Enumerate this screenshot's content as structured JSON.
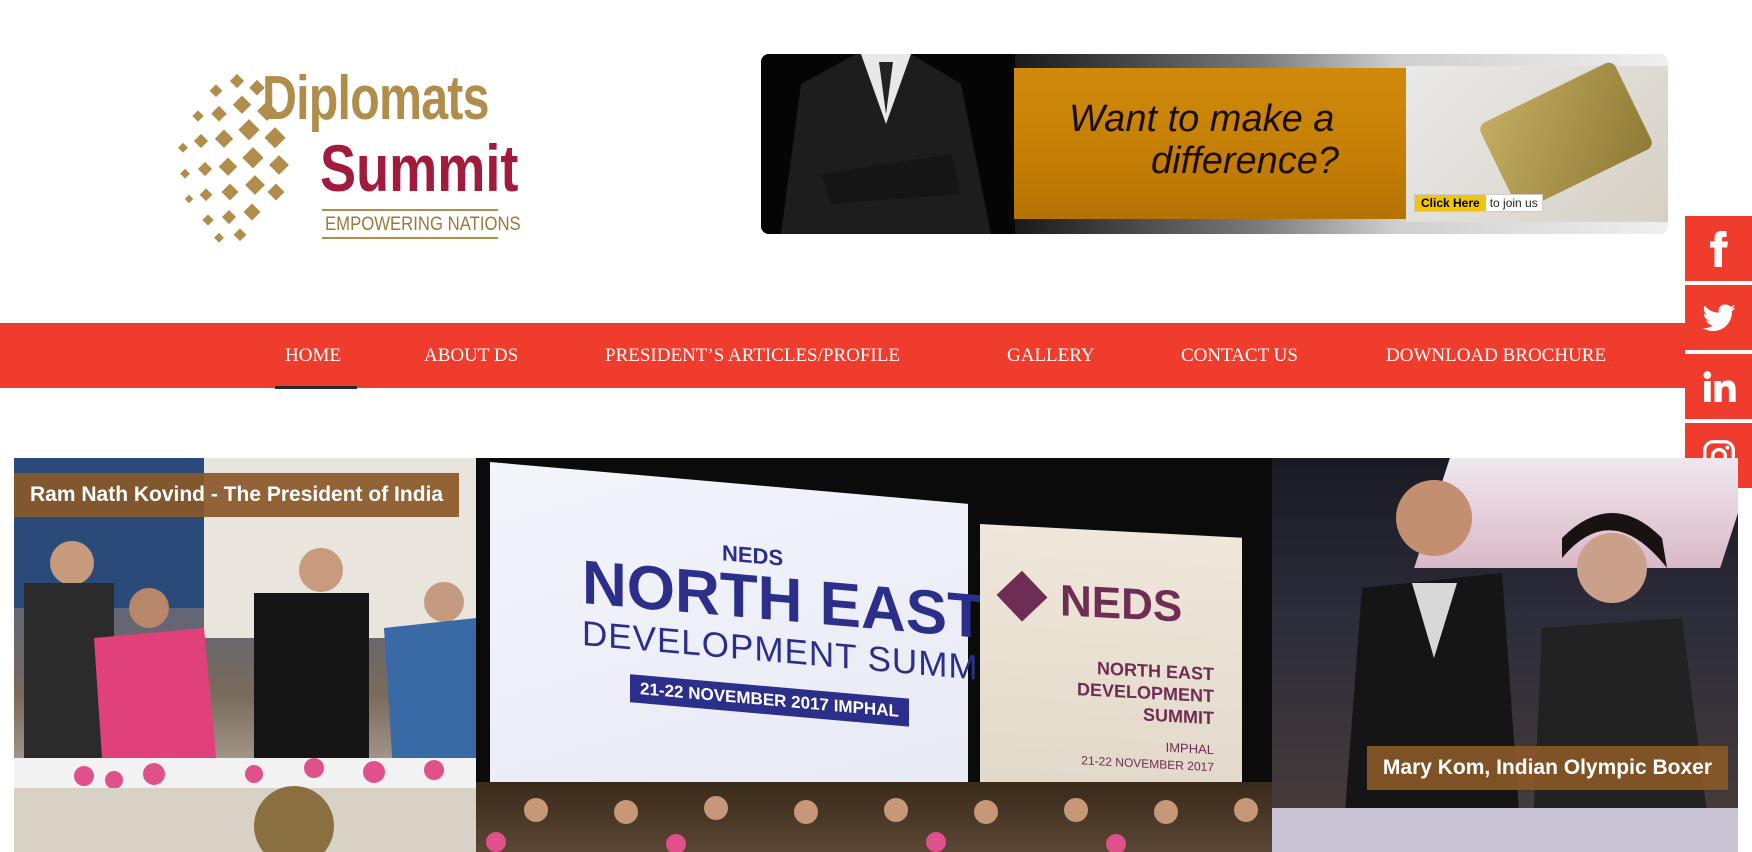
{
  "logo": {
    "line1": "Diplomats",
    "line2": "Summit",
    "tagline": "EMPOWERING NATIONS",
    "colors": {
      "gold": "#b08d4b",
      "crimson": "#a01b3c"
    }
  },
  "banner": {
    "headline_line1": "Want to make a",
    "headline_line2": "difference?",
    "cta_button": "Click Here",
    "cta_text": "to join us"
  },
  "nav": {
    "items": [
      {
        "label": "HOME",
        "active": true
      },
      {
        "label": "ABOUT DS"
      },
      {
        "label": "PRESIDENT’S ARTICLES/PROFILE"
      },
      {
        "label": "GALLERY"
      },
      {
        "label": "CONTACT US"
      },
      {
        "label": "DOWNLOAD BROCHURE"
      }
    ],
    "color": "#f03c2c"
  },
  "social": {
    "items": [
      {
        "icon": "facebook-icon"
      },
      {
        "icon": "twitter-icon"
      },
      {
        "icon": "linkedin-icon"
      },
      {
        "icon": "instagram-icon"
      }
    ]
  },
  "slider": {
    "left_caption": "Ram Nath Kovind - The President of India",
    "right_caption": "Mary Kom, Indian Olympic Boxer",
    "mid": {
      "screen_brand": "NEDS",
      "screen_title": "NORTH EAST",
      "screen_subtitle": "DEVELOPMENT SUMMIT",
      "screen_date": "21-22 NOVEMBER 2017 IMPHAL",
      "poster_brand": "NEDS",
      "poster_line1": "NORTH EAST",
      "poster_line2": "DEVELOPMENT",
      "poster_line3": "SUMMIT",
      "poster_line4": "IMPHAL",
      "poster_line5": "21-22 NOVEMBER 2017"
    }
  }
}
